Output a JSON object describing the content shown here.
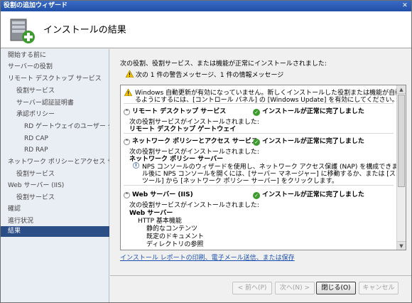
{
  "window": {
    "title": "役割の追加ウィザード",
    "close_glyph": "✕"
  },
  "header": {
    "title": "インストールの結果"
  },
  "sidebar": {
    "items": [
      {
        "label": "開始する前に",
        "level": 0,
        "active": false
      },
      {
        "label": "サーバーの役割",
        "level": 0,
        "active": false
      },
      {
        "label": "リモート デスクトップ サービス",
        "level": 0,
        "active": false
      },
      {
        "label": "役割サービス",
        "level": 1,
        "active": false
      },
      {
        "label": "サーバー認証証明書",
        "level": 1,
        "active": false
      },
      {
        "label": "承認ポリシー",
        "level": 1,
        "active": false
      },
      {
        "label": "RD ゲートウェイのユーザー グ...",
        "level": 2,
        "active": false
      },
      {
        "label": "RD CAP",
        "level": 2,
        "active": false
      },
      {
        "label": "RD RAP",
        "level": 2,
        "active": false
      },
      {
        "label": "ネットワーク ポリシーとアクセス サービ...",
        "level": 0,
        "active": false
      },
      {
        "label": "役割サービス",
        "level": 1,
        "active": false
      },
      {
        "label": "Web サーバー (IIS)",
        "level": 0,
        "active": false
      },
      {
        "label": "役割サービス",
        "level": 1,
        "active": false
      },
      {
        "label": "確認",
        "level": 0,
        "active": false
      },
      {
        "label": "進行状況",
        "level": 0,
        "active": false
      },
      {
        "label": "結果",
        "level": 0,
        "active": true
      }
    ]
  },
  "main": {
    "heading": "次の役割、役割サービス、または機能が正常にインストールされました:",
    "warning_summary": "次の 1 件の警告メッセージ、1 件の情報メッセージ",
    "warning_banner_line1": "Windows 自動更新が有効になっていません。新しくインストールした役割または機能が自動的に更新され",
    "warning_banner_line2": "るようにするには、[コントロール パネル] の [Windows Update] を有効にしてください。",
    "sections": [
      {
        "title": "リモート デスクトップ サービス",
        "status": "インストールが正常に完了しました",
        "installed_label": "次の役割サービスがインストールされました:",
        "service": "リモート デスクトップ ゲートウェイ"
      },
      {
        "title": "ネットワーク ポリシーとアクセス サービス",
        "status": "インストールが正常に完了しました",
        "installed_label": "次の役割サービスがインストールされました:",
        "service": "ネットワーク ポリシー サーバー",
        "info_line1": "NPS コンソールのウィザードを使用し、ネットワーク アクセス保護 (NAP) を構成できます。インストー",
        "info_line2": "ル後に NPS コンソールを開くには、[サーバー マネージャー] に移動するか、または [スタート] の [管理",
        "info_line3": "ツール] から [ネットワーク ポリシー サーバー] をクリックします。"
      },
      {
        "title": "Web サーバー (IIS)",
        "status": "インストールが正常に完了しました",
        "installed_label": "次の役割サービスがインストールされました:",
        "service": "Web サーバー",
        "sub_items": [
          "HTTP 基本機能",
          "静的なコンテンツ",
          "既定のドキュメント",
          "ディレクトリの参照"
        ]
      }
    ],
    "link": "インストール レポートの印刷、電子メール送信、または保存"
  },
  "footer": {
    "back": "< 前へ(P)",
    "next": "次へ(N) >",
    "close": "閉じる(O)",
    "cancel": "キャンセル"
  },
  "colors": {
    "sidebar_active": "#2b4e86",
    "success": "#3d9a2e",
    "link": "#1a4fb0",
    "warning": "#f2c200"
  }
}
